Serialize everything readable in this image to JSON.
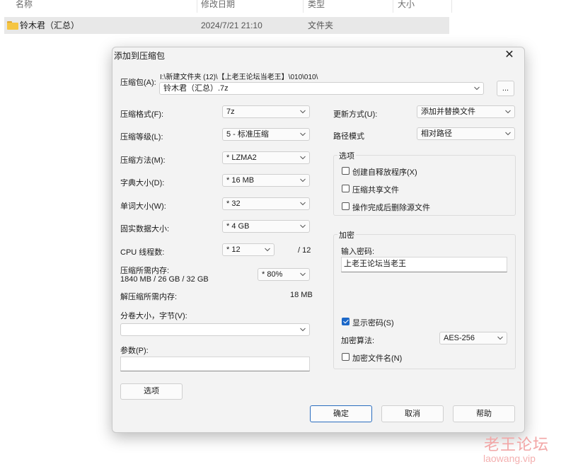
{
  "explorer": {
    "columns": [
      "名称",
      "修改日期",
      "类型",
      "大小"
    ],
    "row": {
      "name": "铃木君（汇总）",
      "date": "2024/7/21 21:10",
      "type": "文件夹"
    }
  },
  "dialog": {
    "title": "添加到压缩包",
    "close_glyph": "✕",
    "archive_label": "压缩包(A):",
    "archive_path": "I:\\新建文件夹 (12)\\【上老王论坛当老王】\\010\\010\\",
    "archive_name": "铃木君（汇总）.7z",
    "browse_label": "...",
    "left": {
      "format_label": "压缩格式(F):",
      "format_value": "7z",
      "level_label": "压缩等级(L):",
      "level_value": "5 - 标准压缩",
      "method_label": "压缩方法(M):",
      "method_value": "* LZMA2",
      "dict_label": "字典大小(D):",
      "dict_value": "* 16 MB",
      "word_label": "单词大小(W):",
      "word_value": "* 32",
      "solid_label": "固实数据大小:",
      "solid_value": "* 4 GB",
      "cpu_label": "CPU 线程数:",
      "cpu_value": "* 12",
      "cpu_total": "/ 12",
      "mem_comp_label": "压缩所需内存:",
      "mem_comp_value": "1840 MB / 26 GB / 32 GB",
      "mem_percent": "* 80%",
      "mem_decomp_label": "解压缩所需内存:",
      "mem_decomp_value": "18 MB",
      "split_label": "分卷大小，字节(V):",
      "split_value": "",
      "params_label": "参数(P):",
      "params_value": "",
      "options_button": "选项"
    },
    "right": {
      "update_label": "更新方式(U):",
      "update_value": "添加并替换文件",
      "pathmode_label": "路径模式",
      "pathmode_value": "相对路径",
      "options_group": "选项",
      "opt_sfx": "创建自释放程序(X)",
      "opt_shared": "压缩共享文件",
      "opt_delete": "操作完成后删除源文件",
      "encrypt_group": "加密",
      "password_label": "输入密码:",
      "password_value": "上老王论坛当老王",
      "show_password": "显示密码(S)",
      "enc_method_label": "加密算法:",
      "enc_method_value": "AES-256",
      "encrypt_names": "加密文件名(N)"
    },
    "buttons": {
      "ok": "确定",
      "cancel": "取消",
      "help": "帮助"
    }
  },
  "watermark": {
    "line1": "老王论坛",
    "line2": "laowang.vip"
  }
}
